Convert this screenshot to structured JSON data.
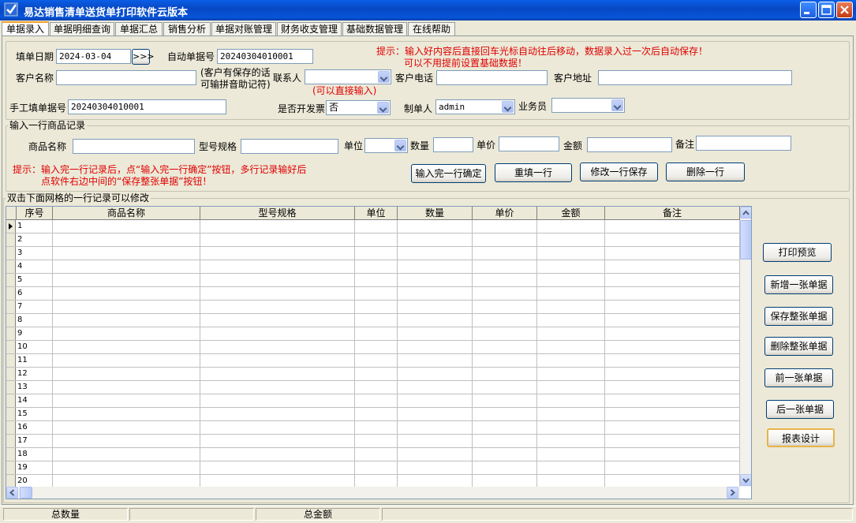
{
  "window": {
    "title": "易达销售清单送货单打印软件云版本"
  },
  "tabs": [
    "单据录入",
    "单据明细查询",
    "单据汇总",
    "销售分析",
    "单据对账管理",
    "财务收支管理",
    "基础数据管理",
    "在线帮助"
  ],
  "form": {
    "date_label": "填单日期",
    "date_value": "2024-03-04",
    "date_btn": ">>>",
    "auto_no_label": "自动单据号",
    "auto_no_value": "20240304010001",
    "tip_line1": "提示：输入好内容后直接回车光标自动往后移动，数据录入过一次后自动保存！",
    "tip_line2": "可以不用提前设置基础数据！",
    "customer_label": "客户名称",
    "customer_value": "",
    "customer_hint_1": "(客户有保存的话",
    "customer_hint_2": "可输拼音助记符)",
    "contact_label": "联系人",
    "contact_value": "",
    "contact_hint": "(可以直接输入)",
    "phone_label": "客户电话",
    "phone_value": "",
    "address_label": "客户地址",
    "address_value": "",
    "manual_no_label": "手工填单据号",
    "manual_no_value": "20240304010001",
    "invoice_label": "是否开发票",
    "invoice_value": "否",
    "maker_label": "制单人",
    "maker_value": "admin",
    "sales_label": "业务员",
    "sales_value": ""
  },
  "item_group": {
    "title": "输入一行商品记录",
    "name_label": "商品名称",
    "spec_label": "型号规格",
    "unit_label": "单位",
    "qty_label": "数量",
    "price_label": "单价",
    "amount_label": "金额",
    "note_label": "备注",
    "tip_line1": "提示：输入完一行记录后，点“输入完一行确定”按钮，多行记录输好后",
    "tip_line2": "点软件右边中间的“保存整张单据”按钮！",
    "btn_confirm": "输入完一行确定",
    "btn_refill": "重填一行",
    "btn_modify": "修改一行保存",
    "btn_delete": "删除一行"
  },
  "grid_group": {
    "title": "双击下面网格的一行记录可以修改"
  },
  "grid": {
    "columns": [
      "序号",
      "商品名称",
      "型号规格",
      "单位",
      "数量",
      "单价",
      "金额",
      "备注"
    ],
    "rows": [
      "1",
      "2",
      "3",
      "4",
      "5",
      "6",
      "7",
      "8",
      "9",
      "10",
      "11",
      "12",
      "13",
      "14",
      "15",
      "16",
      "17",
      "18",
      "19",
      "20"
    ]
  },
  "side_buttons": [
    "打印预览",
    "新增一张单据",
    "保存整张单据",
    "删除整张单据",
    "前一张单据",
    "后一张单据",
    "报表设计"
  ],
  "status": {
    "total_qty_label": "总数量",
    "total_amount_label": "总金额"
  }
}
